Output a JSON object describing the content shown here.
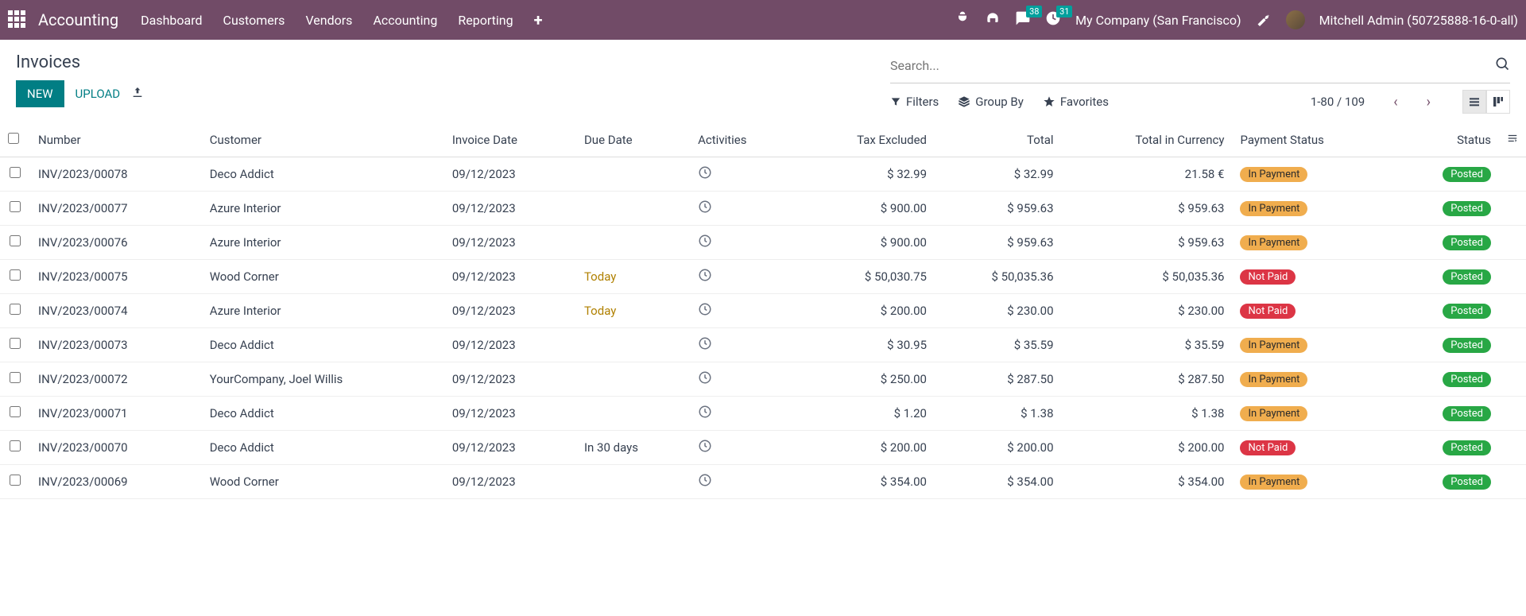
{
  "nav": {
    "brand": "Accounting",
    "items": [
      "Dashboard",
      "Customers",
      "Vendors",
      "Accounting",
      "Reporting"
    ],
    "messages_badge": "38",
    "activities_badge": "31",
    "company": "My Company (San Francisco)",
    "user": "Mitchell Admin (50725888-16-0-all)"
  },
  "header": {
    "title": "Invoices",
    "new_label": "NEW",
    "upload_label": "UPLOAD",
    "search_placeholder": "Search...",
    "filters_label": "Filters",
    "groupby_label": "Group By",
    "favorites_label": "Favorites",
    "pager": "1-80 / 109"
  },
  "columns": {
    "number": "Number",
    "customer": "Customer",
    "invoice_date": "Invoice Date",
    "due_date": "Due Date",
    "activities": "Activities",
    "tax_excluded": "Tax Excluded",
    "total": "Total",
    "total_currency": "Total in Currency",
    "payment_status": "Payment Status",
    "status": "Status"
  },
  "payment_labels": {
    "in_payment": "In Payment",
    "not_paid": "Not Paid"
  },
  "status_labels": {
    "posted": "Posted"
  },
  "rows": [
    {
      "number": "INV/2023/00078",
      "customer": "Deco Addict",
      "invoice_date": "09/12/2023",
      "due_date": "",
      "tax_excluded": "$ 32.99",
      "total": "$ 32.99",
      "total_currency": "21.58 €",
      "payment": "in_payment",
      "status": "posted"
    },
    {
      "number": "INV/2023/00077",
      "customer": "Azure Interior",
      "invoice_date": "09/12/2023",
      "due_date": "",
      "tax_excluded": "$ 900.00",
      "total": "$ 959.63",
      "total_currency": "$ 959.63",
      "payment": "in_payment",
      "status": "posted"
    },
    {
      "number": "INV/2023/00076",
      "customer": "Azure Interior",
      "invoice_date": "09/12/2023",
      "due_date": "",
      "tax_excluded": "$ 900.00",
      "total": "$ 959.63",
      "total_currency": "$ 959.63",
      "payment": "in_payment",
      "status": "posted"
    },
    {
      "number": "INV/2023/00075",
      "customer": "Wood Corner",
      "invoice_date": "09/12/2023",
      "due_date": "Today",
      "due_class": "due-today",
      "tax_excluded": "$ 50,030.75",
      "total": "$ 50,035.36",
      "total_currency": "$ 50,035.36",
      "payment": "not_paid",
      "status": "posted"
    },
    {
      "number": "INV/2023/00074",
      "customer": "Azure Interior",
      "invoice_date": "09/12/2023",
      "due_date": "Today",
      "due_class": "due-today",
      "tax_excluded": "$ 200.00",
      "total": "$ 230.00",
      "total_currency": "$ 230.00",
      "payment": "not_paid",
      "status": "posted"
    },
    {
      "number": "INV/2023/00073",
      "customer": "Deco Addict",
      "invoice_date": "09/12/2023",
      "due_date": "",
      "tax_excluded": "$ 30.95",
      "total": "$ 35.59",
      "total_currency": "$ 35.59",
      "payment": "in_payment",
      "status": "posted"
    },
    {
      "number": "INV/2023/00072",
      "customer": "YourCompany, Joel Willis",
      "invoice_date": "09/12/2023",
      "due_date": "",
      "tax_excluded": "$ 250.00",
      "total": "$ 287.50",
      "total_currency": "$ 287.50",
      "payment": "in_payment",
      "status": "posted"
    },
    {
      "number": "INV/2023/00071",
      "customer": "Deco Addict",
      "invoice_date": "09/12/2023",
      "due_date": "",
      "tax_excluded": "$ 1.20",
      "total": "$ 1.38",
      "total_currency": "$ 1.38",
      "payment": "in_payment",
      "status": "posted"
    },
    {
      "number": "INV/2023/00070",
      "customer": "Deco Addict",
      "invoice_date": "09/12/2023",
      "due_date": "In 30 days",
      "tax_excluded": "$ 200.00",
      "total": "$ 200.00",
      "total_currency": "$ 200.00",
      "payment": "not_paid",
      "status": "posted"
    },
    {
      "number": "INV/2023/00069",
      "customer": "Wood Corner",
      "invoice_date": "09/12/2023",
      "due_date": "",
      "tax_excluded": "$ 354.00",
      "total": "$ 354.00",
      "total_currency": "$ 354.00",
      "payment": "in_payment",
      "status": "posted"
    }
  ]
}
